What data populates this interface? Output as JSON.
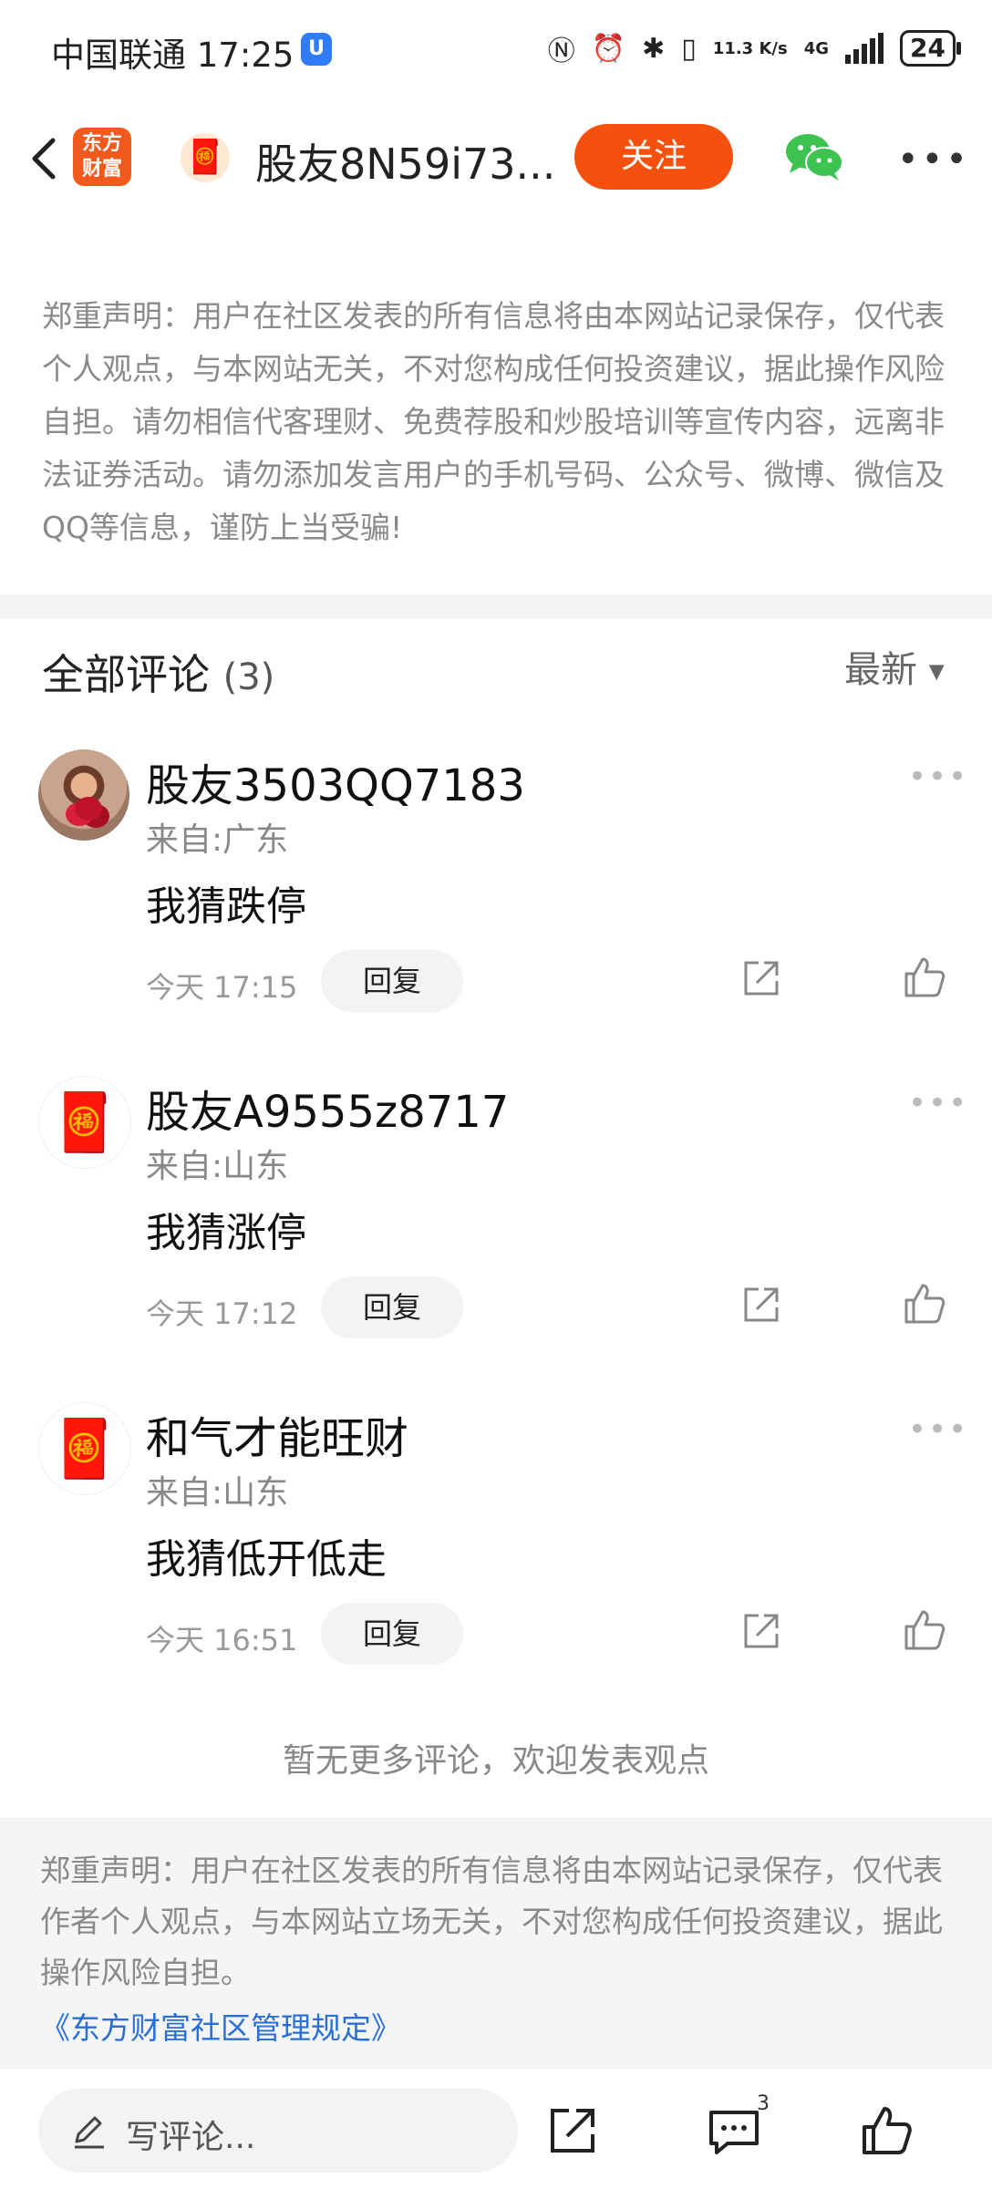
{
  "status_bar": {
    "carrier": "中国联通",
    "time": "17:25",
    "net_speed": "11.3 K/s",
    "network": "4G",
    "battery": "24"
  },
  "header": {
    "app_logo_line1": "东方",
    "app_logo_line2": "财富",
    "title": "股友8N59i73...",
    "follow_label": "关注"
  },
  "disclaimer_top": "郑重声明：用户在社区发表的所有信息将由本网站记录保存，仅代表个人观点，与本网站无关，不对您构成任何投资建议，据此操作风险自担。请勿相信代客理财、免费荐股和炒股培训等宣传内容，远离非法证券活动。请勿添加发言用户的手机号码、公众号、微博、微信及QQ等信息，谨防上当受骗!",
  "comments_section": {
    "title": "全部评论",
    "count": "(3)",
    "sort_label": "最新"
  },
  "comments": [
    {
      "name": "股友3503QQ7183",
      "from": "来自:广东",
      "text": "我猜跌停",
      "time": "今天 17:15",
      "reply_label": "回复"
    },
    {
      "name": "股友A9555z8717",
      "from": "来自:山东",
      "text": "我猜涨停",
      "time": "今天 17:12",
      "reply_label": "回复"
    },
    {
      "name": "和气才能旺财",
      "from": "来自:山东",
      "text": "我猜低开低走",
      "time": "今天 16:51",
      "reply_label": "回复"
    }
  ],
  "no_more_text": "暂无更多评论，欢迎发表观点",
  "disclaimer_bottom": "郑重声明：用户在社区发表的所有信息将由本网站记录保存，仅代表作者个人观点，与本网站立场无关，不对您构成任何投资建议，据此操作风险自担。",
  "rules_link": "《东方财富社区管理规定》",
  "bottom_bar": {
    "write_placeholder": "写评论...",
    "comment_count": "3"
  },
  "colors": {
    "accent": "#f5510e",
    "link": "#2a6fd6",
    "wechat": "#3ec351"
  },
  "icons": [
    "back-arrow-icon",
    "wechat-share-icon",
    "more-dots-icon",
    "share-icon",
    "thumbs-up-icon",
    "pencil-icon",
    "comment-icon"
  ]
}
